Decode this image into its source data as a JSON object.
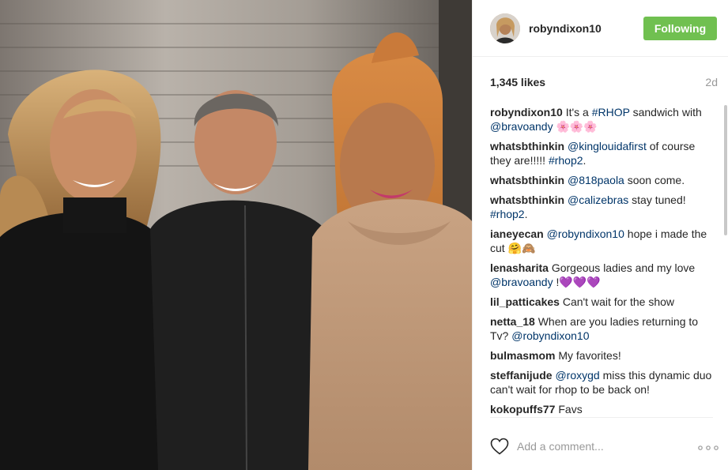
{
  "post": {
    "username": "robyndixon10",
    "follow_label": "Following",
    "likes": "1,345 likes",
    "age": "2d",
    "add_comment_placeholder": "Add a comment..."
  },
  "comments": [
    {
      "user": "robyndixon10",
      "parts": [
        {
          "t": "text",
          "v": "It's a "
        },
        {
          "t": "tag",
          "v": "#RHOP"
        },
        {
          "t": "text",
          "v": " sandwich with "
        },
        {
          "t": "tag",
          "v": "@bravoandy"
        },
        {
          "t": "text",
          "v": " 🌸🌸🌸"
        }
      ]
    },
    {
      "user": "whatsbthinkin",
      "parts": [
        {
          "t": "tag",
          "v": "@kinglouidafirst"
        },
        {
          "t": "text",
          "v": " of course they are!!!!! "
        },
        {
          "t": "tag",
          "v": "#rhop2"
        },
        {
          "t": "text",
          "v": "."
        }
      ]
    },
    {
      "user": "whatsbthinkin",
      "parts": [
        {
          "t": "tag",
          "v": "@818paola"
        },
        {
          "t": "text",
          "v": " soon come."
        }
      ]
    },
    {
      "user": "whatsbthinkin",
      "parts": [
        {
          "t": "tag",
          "v": "@calizebras"
        },
        {
          "t": "text",
          "v": " stay tuned! "
        },
        {
          "t": "tag",
          "v": "#rhop2"
        },
        {
          "t": "text",
          "v": "."
        }
      ]
    },
    {
      "user": "ianeyecan",
      "parts": [
        {
          "t": "tag",
          "v": "@robyndixon10"
        },
        {
          "t": "text",
          "v": " hope i made the cut 🤗🙈"
        }
      ]
    },
    {
      "user": "lenasharita",
      "parts": [
        {
          "t": "text",
          "v": "Gorgeous ladies and my love "
        },
        {
          "t": "tag",
          "v": "@bravoandy"
        },
        {
          "t": "text",
          "v": " !💜💜💜"
        }
      ]
    },
    {
      "user": "lil_patticakes",
      "parts": [
        {
          "t": "text",
          "v": "Can't wait for the show"
        }
      ]
    },
    {
      "user": "netta_18",
      "parts": [
        {
          "t": "text",
          "v": "When are you ladies returning to Tv? "
        },
        {
          "t": "tag",
          "v": "@robyndixon10"
        }
      ]
    },
    {
      "user": "bulmasmom",
      "parts": [
        {
          "t": "text",
          "v": "My favorites!"
        }
      ]
    },
    {
      "user": "steffanijude",
      "parts": [
        {
          "t": "tag",
          "v": "@roxygd"
        },
        {
          "t": "text",
          "v": " miss this dynamic duo can't wait for rhop to be back on!"
        }
      ]
    },
    {
      "user": "kokopuffs77",
      "parts": [
        {
          "t": "text",
          "v": "Favs"
        }
      ]
    }
  ],
  "icons": {
    "avatar": "avatar",
    "heart": "heart-icon",
    "more": "more-options-icon"
  },
  "colors": {
    "follow_button": "#70c050",
    "link": "#003569",
    "muted": "#999999"
  }
}
